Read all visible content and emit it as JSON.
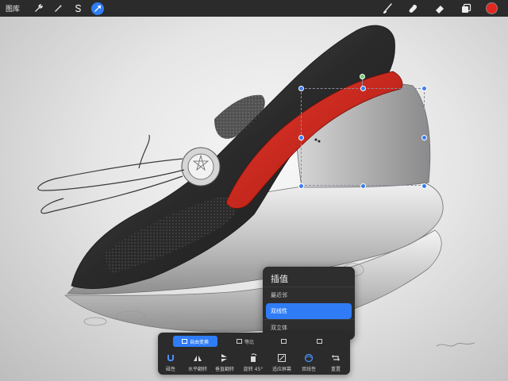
{
  "toolbar": {
    "gallery_label": "图库",
    "left_tools": [
      "wrench-icon",
      "magic-wand-icon",
      "selection-s-icon",
      "transform-arrow-icon"
    ],
    "right_tools": [
      "brush-icon",
      "smudge-icon",
      "eraser-icon",
      "layers-icon"
    ],
    "active_tool": "transform-arrow-icon",
    "current_color": "#e2271f"
  },
  "popover": {
    "title": "插值",
    "options": [
      "最近邻",
      "双线性",
      "双立体"
    ],
    "selected": "双线性"
  },
  "transform": {
    "modes": [
      "自由变换",
      "等比",
      "",
      ""
    ],
    "active_mode": "自由变换",
    "actions": [
      "磁性",
      "水平翻转",
      "垂直翻转",
      "旋转 45°",
      "适应屏幕",
      "双线性",
      "重置"
    ]
  },
  "colors": {
    "accent": "#2f7cf6",
    "toolbar_bg": "#2b2b2b",
    "shoe_red": "#c9261c"
  }
}
